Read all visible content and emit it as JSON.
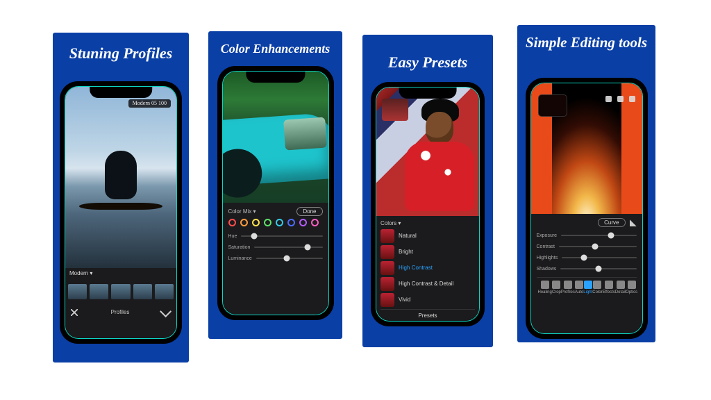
{
  "cards": [
    {
      "title": "Stuning Profiles",
      "badge": "Modern 05  100",
      "strip_label": "Modern ▾",
      "footer": "Profiles"
    },
    {
      "title": "Color Enhancements",
      "panel_label": "Color Mix ▾",
      "done": "Done",
      "dots": [
        "#ff4d4d",
        "#ff9a3d",
        "#ffe24d",
        "#5fe06a",
        "#35c9e6",
        "#4d6bff",
        "#b45cff",
        "#ff5cc1"
      ],
      "sliders": [
        {
          "name": "Hue",
          "pos": 0.16
        },
        {
          "name": "Saturation",
          "pos": 0.78
        },
        {
          "name": "Luminance",
          "pos": 0.46
        }
      ]
    },
    {
      "title": "Easy Presets",
      "panel_label": "Colors ▾",
      "items": [
        {
          "name": "Natural",
          "sel": false
        },
        {
          "name": "Bright",
          "sel": false
        },
        {
          "name": "High Contrast",
          "sel": true
        },
        {
          "name": "High Contrast & Detail",
          "sel": false
        },
        {
          "name": "Vivid",
          "sel": false
        }
      ],
      "footer": "Presets"
    },
    {
      "title": "Simple Editing tools",
      "curve": "Curve",
      "sliders": [
        {
          "name": "Exposure",
          "pos": 0.66
        },
        {
          "name": "Contrast",
          "pos": 0.47
        },
        {
          "name": "Highlights",
          "pos": 0.3
        },
        {
          "name": "Shadows",
          "pos": 0.5
        }
      ],
      "tools": [
        "Healing",
        "Crop",
        "Profiles",
        "Auto",
        "Light",
        "Color",
        "Effects",
        "Detail",
        "Optics"
      ],
      "tool_sel": 4
    }
  ]
}
